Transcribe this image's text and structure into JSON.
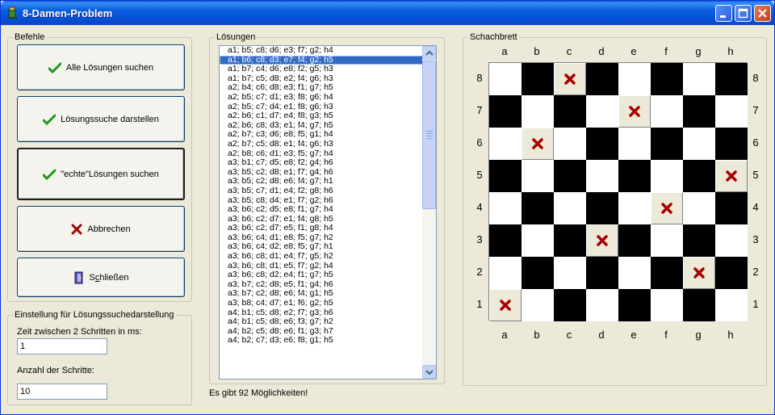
{
  "window": {
    "title": "8-Damen-Problem"
  },
  "commands": {
    "group_title": "Befehle",
    "find_all": "Alle Lösungen suchen",
    "show_search": "Lösungssuche darstellen",
    "find_real": "\"echte\"Lösungen suchen",
    "cancel": "Abbrechen",
    "close_prefix": "S",
    "close_accel": "c",
    "close_rest": "hließen"
  },
  "settings": {
    "group_title": "Einstellung für Lösungssuchedarstellung",
    "delay_label": "Zeit zwischen 2 Schritten in ms:",
    "delay_value": "1",
    "steps_label": "Anzahl der Schritte:",
    "steps_value": "10"
  },
  "solutions": {
    "group_title": "Lösungen",
    "selected_index": 1,
    "items": [
      "a1; b5; c8; d6; e3; f7; g2; h4",
      "a1; b6; c8; d3; e7; f4; g2; h5",
      "a1; b7; c4; d6; e8; f2; g5; h3",
      "a1; b7; c5; d8; e2; f4; g6; h3",
      "a2; b4; c6; d8; e3; f1; g7; h5",
      "a2; b5; c7; d1; e3; f8; g6; h4",
      "a2; b5; c7; d4; e1; f8; g6; h3",
      "a2; b6; c1; d7; e4; f8; g3; h5",
      "a2; b6; c8; d3; e1; f4; g7; h5",
      "a2; b7; c3; d6; e8; f5; g1; h4",
      "a2; b7; c5; d8; e1; f4; g6; h3",
      "a2; b8; c6; d1; e3; f5; g7; h4",
      "a3; b1; c7; d5; e8; f2; g4; h6",
      "a3; b5; c2; d8; e1; f7; g4; h6",
      "a3; b5; c2; d8; e6; f4; g7; h1",
      "a3; b5; c7; d1; e4; f2; g8; h6",
      "a3; b5; c8; d4; e1; f7; g2; h6",
      "a3; b6; c2; d5; e8; f1; g7; h4",
      "a3; b6; c2; d7; e1; f4; g8; h5",
      "a3; b6; c2; d7; e5; f1; g8; h4",
      "a3; b6; c4; d1; e8; f5; g7; h2",
      "a3; b6; c4; d2; e8; f5; g7; h1",
      "a3; b6; c8; d1; e4; f7; g5; h2",
      "a3; b6; c8; d1; e5; f7; g2; h4",
      "a3; b6; c8; d2; e4; f1; g7; h5",
      "a3; b7; c2; d8; e5; f1; g4; h6",
      "a3; b7; c2; d8; e6; f4; g1; h5",
      "a3; b8; c4; d7; e1; f6; g2; h5",
      "a4; b1; c5; d8; e2; f7; g3; h6",
      "a4; b1; c5; d8; e6; f3; g7; h2",
      "a4; b2; c5; d8; e6; f1; g3; h7",
      "a4; b2; c7; d3; e6; f8; g1; h5"
    ],
    "status": "Es gibt 92 Möglichkeiten!"
  },
  "board": {
    "group_title": "Schachbrett",
    "files": [
      "a",
      "b",
      "c",
      "d",
      "e",
      "f",
      "g",
      "h"
    ],
    "ranks": [
      "8",
      "7",
      "6",
      "5",
      "4",
      "3",
      "2",
      "1"
    ],
    "queens": [
      "a1",
      "b6",
      "c8",
      "d3",
      "e7",
      "f4",
      "g2",
      "h5"
    ],
    "queen_icon": "red-x-icon",
    "colors": {
      "light": "#ffffff",
      "dark": "#000000",
      "marker": "#a80000"
    }
  }
}
